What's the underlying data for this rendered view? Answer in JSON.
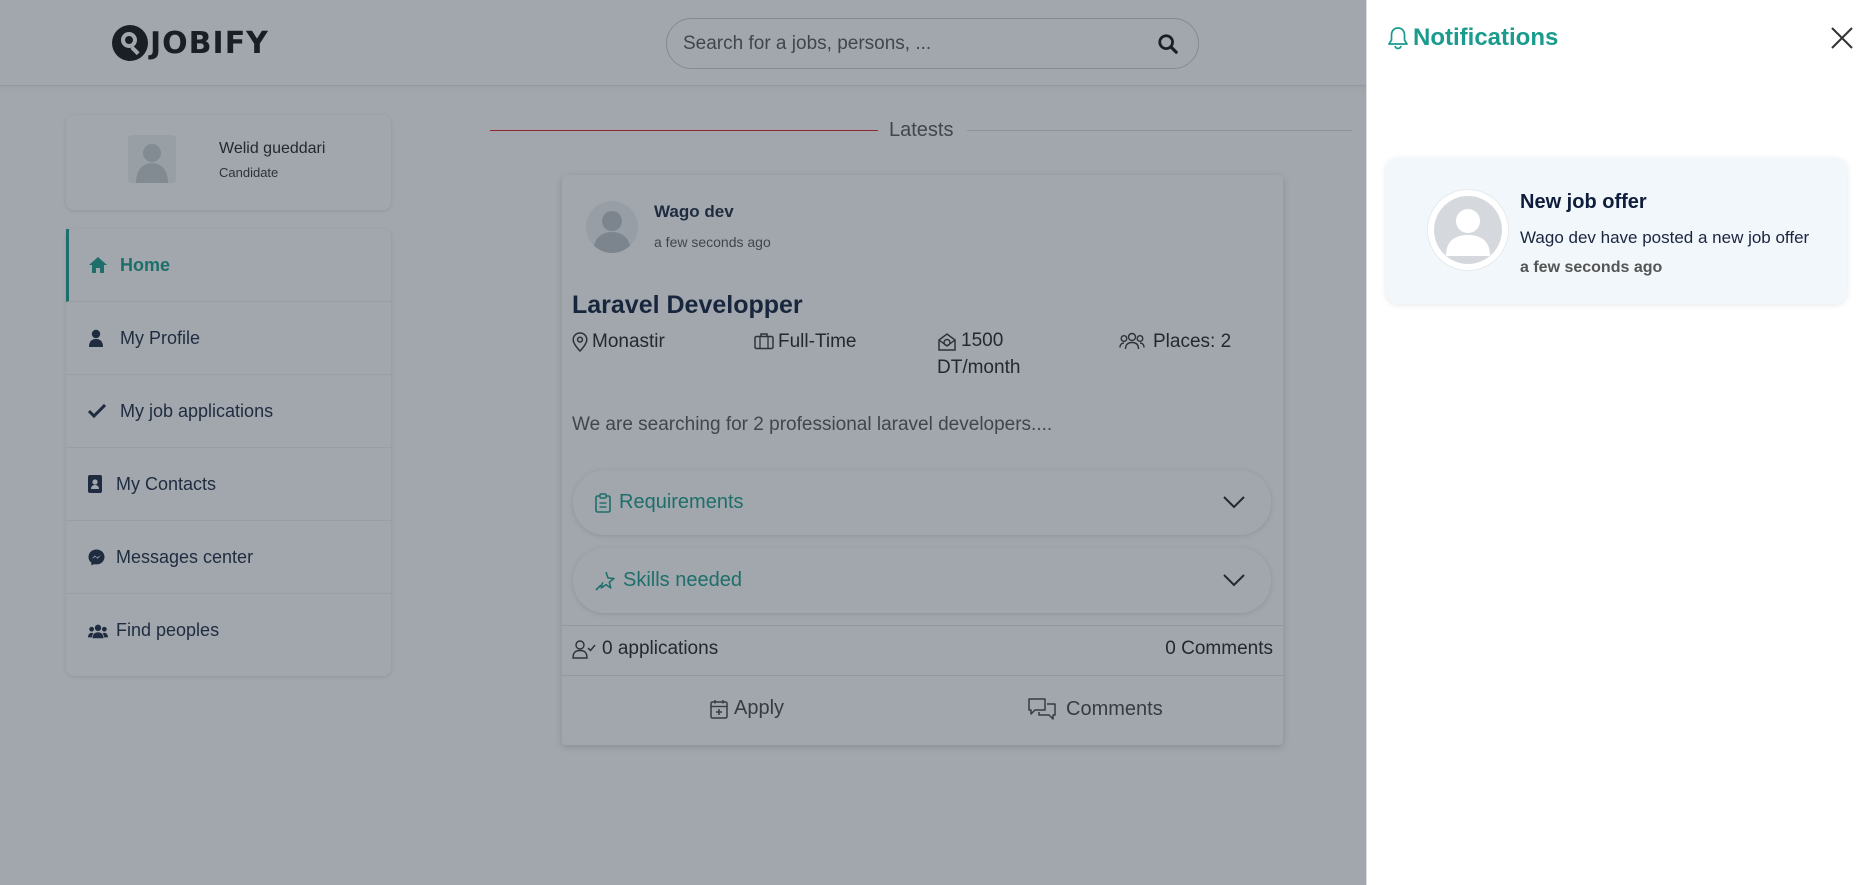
{
  "brand": {
    "name": "JOBIFY",
    "accent": "#1a9b8e"
  },
  "search": {
    "placeholder": "Search for a jobs, persons, ...",
    "value": ""
  },
  "profile": {
    "name": "Welid gueddari",
    "role": "Candidate"
  },
  "nav": {
    "items": [
      {
        "label": "Home",
        "icon": "home-icon",
        "active": true
      },
      {
        "label": "My Profile",
        "icon": "user-icon"
      },
      {
        "label": "My job applications",
        "icon": "check-icon"
      },
      {
        "label": "My Contacts",
        "icon": "contact-book-icon"
      },
      {
        "label": "Messages center",
        "icon": "messenger-icon"
      },
      {
        "label": "Find peoples",
        "icon": "users-icon"
      }
    ]
  },
  "feed": {
    "section_title": "Latests",
    "post": {
      "author": "Wago dev",
      "time": "a few seconds ago",
      "title": "Laravel Developper",
      "location": "Monastir",
      "contract": "Full-Time",
      "salary_line1": "1500",
      "salary_line2": "DT/month",
      "places": "Places: 2",
      "description": "We are searching for 2 professional laravel developers....",
      "requirements_label": "Requirements",
      "skills_label": "Skills needed",
      "applications": "0 applications",
      "comments_count": "0 Comments",
      "apply_label": "Apply",
      "comments_label": "Comments"
    }
  },
  "notifications": {
    "title": "Notifications",
    "items": [
      {
        "title": "New job offer",
        "body": "Wago dev have posted a new job offer",
        "time": "a few seconds ago"
      }
    ]
  }
}
